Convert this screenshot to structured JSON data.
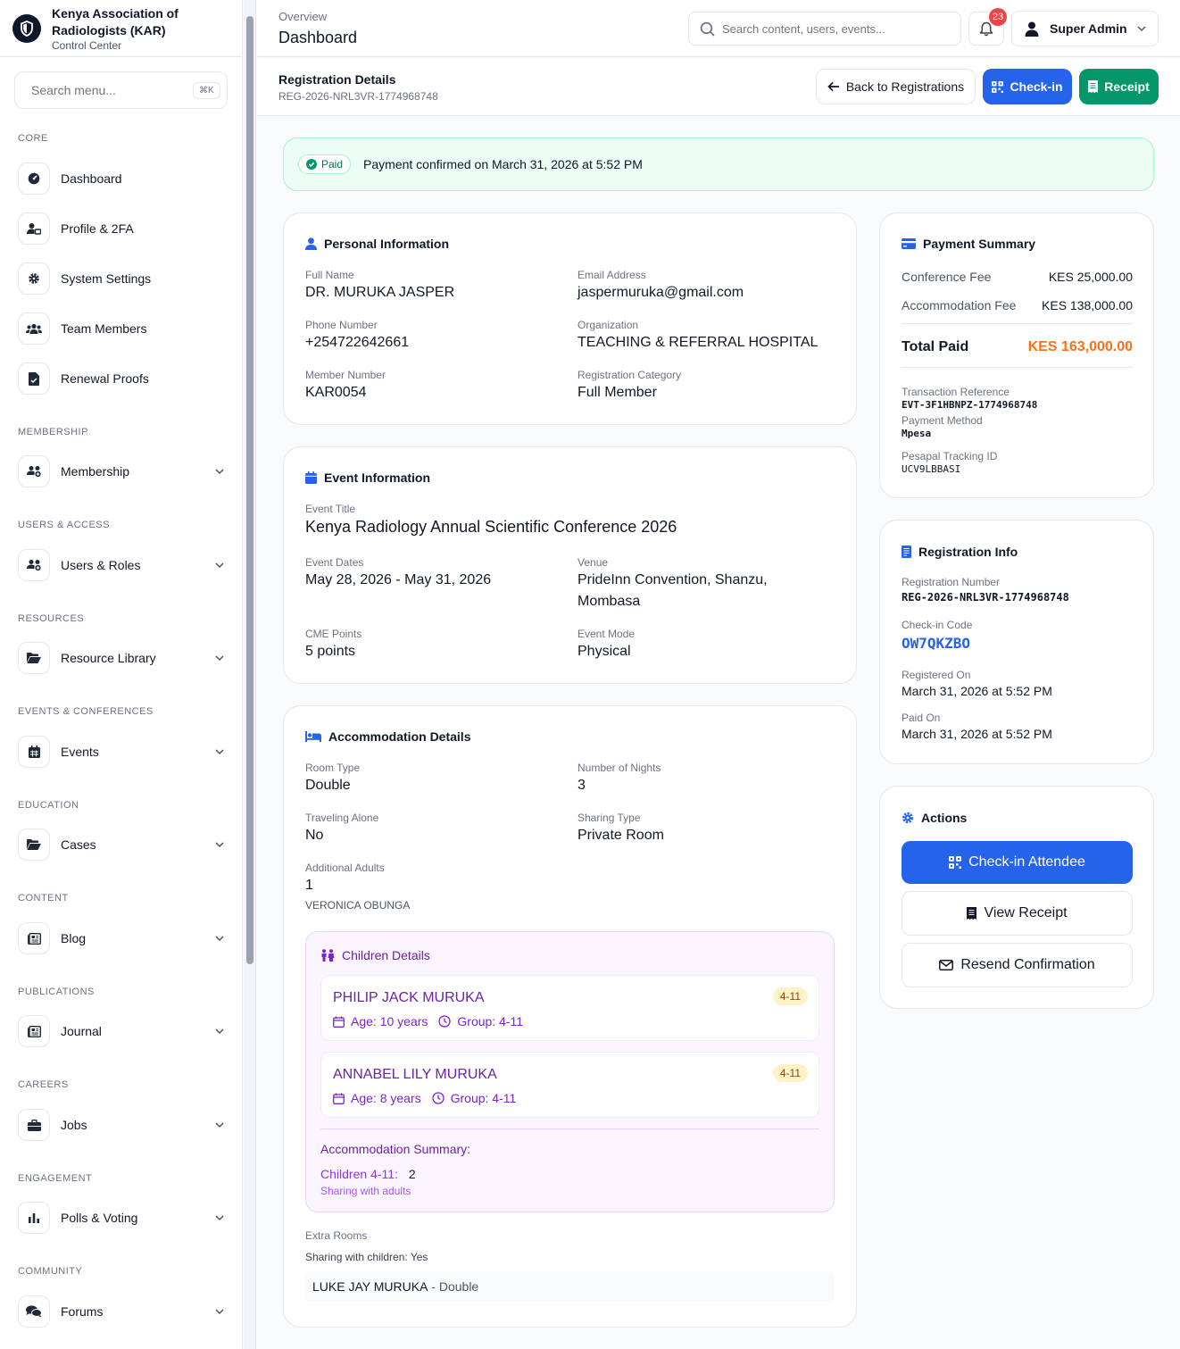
{
  "brand": {
    "name_line1": "Kenya Association of",
    "name_line2": "Radiologists (KAR)",
    "subtitle": "Control Center"
  },
  "menu_search": {
    "placeholder": "Search menu...",
    "shortcut": "⌘K"
  },
  "sidebar": {
    "sections": [
      {
        "label": "CORE"
      },
      {
        "label": "MEMBERSHIP"
      },
      {
        "label": "USERS & ACCESS"
      },
      {
        "label": "RESOURCES"
      },
      {
        "label": "EVENTS & CONFERENCES"
      },
      {
        "label": "EDUCATION"
      },
      {
        "label": "CONTENT"
      },
      {
        "label": "PUBLICATIONS"
      },
      {
        "label": "CAREERS"
      },
      {
        "label": "ENGAGEMENT"
      },
      {
        "label": "COMMUNITY"
      }
    ],
    "items": [
      {
        "label": "Dashboard",
        "icon": "dashboard-icon"
      },
      {
        "label": "Profile & 2FA",
        "icon": "user-lock-icon"
      },
      {
        "label": "System Settings",
        "icon": "gear-icon"
      },
      {
        "label": "Team Members",
        "icon": "users-icon"
      },
      {
        "label": "Renewal Proofs",
        "icon": "file-check-icon"
      },
      {
        "label": "Membership",
        "icon": "users-group-icon"
      },
      {
        "label": "Users & Roles",
        "icon": "users-group-icon"
      },
      {
        "label": "Resource Library",
        "icon": "folder-open-icon"
      },
      {
        "label": "Events",
        "icon": "calendar-icon"
      },
      {
        "label": "Cases",
        "icon": "folder-open-icon"
      },
      {
        "label": "Blog",
        "icon": "newspaper-icon"
      },
      {
        "label": "Journal",
        "icon": "newspaper-icon"
      },
      {
        "label": "Jobs",
        "icon": "briefcase-icon"
      },
      {
        "label": "Polls & Voting",
        "icon": "bar-chart-icon"
      },
      {
        "label": "Forums",
        "icon": "comments-icon"
      }
    ]
  },
  "header": {
    "breadcrumb": "Overview",
    "title": "Dashboard",
    "search_placeholder": "Search content, users, events...",
    "notification_count": "23",
    "user_name": "Super Admin"
  },
  "subheader": {
    "title": "Registration Details",
    "reference": "REG-2026-NRL3VR-1774968748",
    "back_label": "Back to Registrations",
    "checkin_label": "Check-in",
    "receipt_label": "Receipt"
  },
  "banner": {
    "status": "Paid",
    "message": "Payment confirmed on March 31, 2026 at 5:52 PM"
  },
  "personal": {
    "title": "Personal Information",
    "full_name_label": "Full Name",
    "full_name": "DR. MURUKA JASPER",
    "email_label": "Email Address",
    "email": "jaspermuruka@gmail.com",
    "phone_label": "Phone Number",
    "phone": "+254722642661",
    "org_label": "Organization",
    "org": "TEACHING & REFERRAL HOSPITAL",
    "member_label": "Member Number",
    "member": "KAR0054",
    "category_label": "Registration Category",
    "category": "Full Member"
  },
  "event": {
    "title": "Event Information",
    "event_title_label": "Event Title",
    "event_title": "Kenya Radiology Annual Scientific Conference 2026",
    "dates_label": "Event Dates",
    "dates": "May 28, 2026 - May 31, 2026",
    "venue_label": "Venue",
    "venue_line1": "PrideInn Convention, Shanzu,",
    "venue_line2": "Mombasa",
    "cme_label": "CME Points",
    "cme": "5 points",
    "mode_label": "Event Mode",
    "mode": "Physical"
  },
  "accommodation": {
    "title": "Accommodation Details",
    "room_label": "Room Type",
    "room": "Double",
    "nights_label": "Number of Nights",
    "nights": "3",
    "alone_label": "Traveling Alone",
    "alone": "No",
    "sharing_label": "Sharing Type",
    "sharing": "Private Room",
    "adults_label": "Additional Adults",
    "adults": "1",
    "adult_name": "VERONICA OBUNGA",
    "children_title": "Children Details",
    "children": [
      {
        "name": "PHILIP JACK MURUKA",
        "age": "Age: 10 years",
        "group": "Group: 4-11",
        "badge": "4-11"
      },
      {
        "name": "ANNABEL LILY MURUKA",
        "age": "Age: 8 years",
        "group": "Group: 4-11",
        "badge": "4-11"
      }
    ],
    "summary_title": "Accommodation Summary:",
    "summary_label": "Children 4-11:",
    "summary_count": "2",
    "summary_note": "Sharing with adults",
    "extra_rooms_label": "Extra Rooms",
    "extra_sharing": "Sharing with children: Yes",
    "extra_room_name": "LUKE JAY MURUKA",
    "extra_room_type": " - Double"
  },
  "payment": {
    "title": "Payment Summary",
    "conf_label": "Conference Fee",
    "conf": "KES 25,000.00",
    "acc_label": "Accommodation Fee",
    "acc": "KES 138,000.00",
    "total_label": "Total Paid",
    "total": "KES 163,000.00",
    "txn_label": "Transaction Reference",
    "txn": "EVT-3F1HBNPZ-1774968748",
    "method_label": "Payment Method",
    "method": "Mpesa",
    "tracking_label": "Pesapal Tracking ID",
    "tracking": "UCV9LBBASI"
  },
  "reginfo": {
    "title": "Registration Info",
    "number_label": "Registration Number",
    "number": "REG-2026-NRL3VR-1774968748",
    "code_label": "Check-in Code",
    "code": "OW7QKZBO",
    "registered_label": "Registered On",
    "registered": "March 31, 2026 at 5:52 PM",
    "paid_label": "Paid On",
    "paid": "March 31, 2026 at 5:52 PM"
  },
  "actions": {
    "title": "Actions",
    "checkin": "Check-in Attendee",
    "view_receipt": "View Receipt",
    "resend": "Resend Confirmation"
  },
  "colors": {
    "primary": "#2563eb",
    "success": "#059669",
    "accent": "#f97316",
    "purple": "#6b21a8"
  }
}
